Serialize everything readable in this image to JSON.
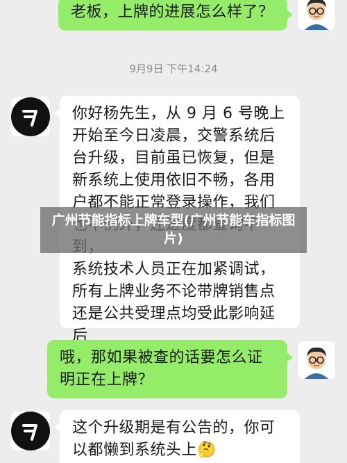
{
  "messages": [
    {
      "side": "out",
      "text": "老板，上牌的进展怎么样了？"
    },
    {
      "side": "in",
      "text": "你好杨先生，从 9 月 6 号晚上\n开始至今日凌晨，交警系统后\n台升级，目前虽已恢复，但是\n新系统上使用依旧不畅，各用\n户都不能正常登录操作，我们\n也不例外，还进度都查询不到，\n系统技术人员正在加紧调试，\n所有上牌业务不论带牌销售点\n还是公共受理点均受此影响延\n后"
    },
    {
      "side": "out",
      "text": "哦，那如果被查的话要怎么证\n明正在上牌？"
    },
    {
      "side": "in",
      "text": "这个升级期是有公告的，你可\n以都懒到系统头上🤔"
    }
  ],
  "timestamp": "9月9日 下午14:24",
  "watermark": "广州节能指标上牌车型(广州节能车指标图片)",
  "colors": {
    "background": "#ededed",
    "outgoing": "#95ec69",
    "incoming": "#ffffff"
  },
  "icons": {
    "user_avatar": "cartoon-man-with-glasses-icon",
    "agent_avatar": "brand-logo-icon"
  }
}
